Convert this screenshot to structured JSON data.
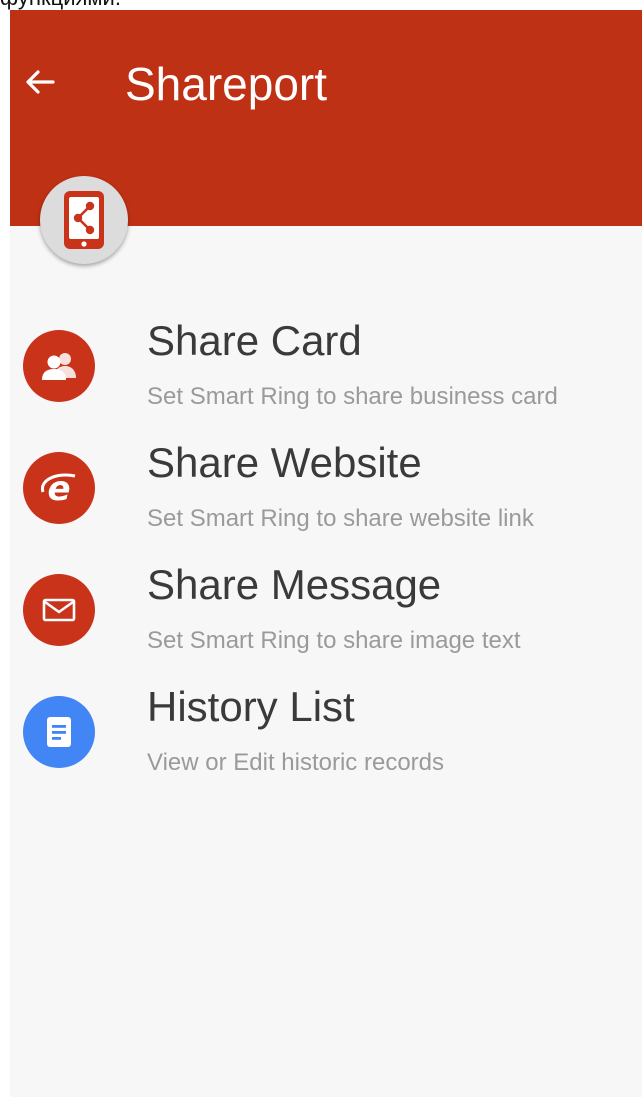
{
  "top_caption": "функциями.",
  "appbar": {
    "title": "Shareport",
    "back_icon": "arrow-left-icon",
    "badge_icon": "phone-share-icon"
  },
  "colors": {
    "appbar": "#bf3115",
    "red_icon": "#c8331a",
    "blue_icon": "#4285f4",
    "background": "#f7f7f7"
  },
  "menu": {
    "items": [
      {
        "title": "Share Card",
        "subtitle": "Set Smart Ring to share business card",
        "icon": "contacts-icon",
        "color": "#c8331a"
      },
      {
        "title": "Share Website",
        "subtitle": "Set Smart Ring to share website link",
        "icon": "internet-explorer-icon",
        "color": "#c8331a"
      },
      {
        "title": "Share Message",
        "subtitle": "Set Smart Ring to share image text",
        "icon": "envelope-icon",
        "color": "#c8331a"
      },
      {
        "title": "History List",
        "subtitle": "View or Edit historic records",
        "icon": "document-icon",
        "color": "#4285f4"
      }
    ]
  }
}
